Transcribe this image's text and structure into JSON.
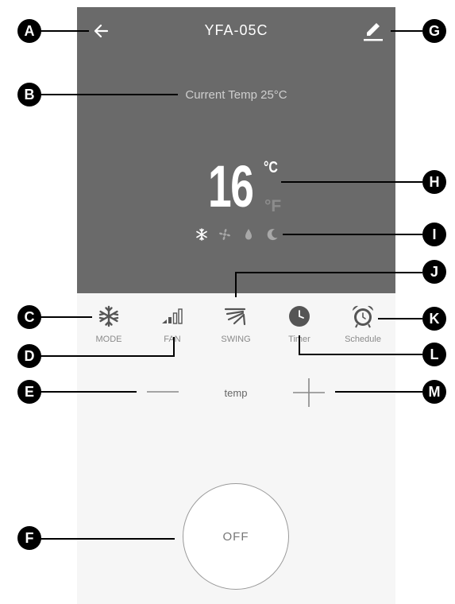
{
  "device": {
    "title": "YFA-05C",
    "current_temp_text": "Current Temp 25°C",
    "set_temp": "16",
    "unit_celsius": "°C",
    "unit_fahrenheit": "°F",
    "mode_indicators": [
      "snowflake-icon",
      "fan-icon",
      "droplet-icon",
      "moon-icon"
    ]
  },
  "functions": [
    {
      "label": "MODE",
      "icon": "snowflake-icon"
    },
    {
      "label": "FAN",
      "icon": "signal-bars-icon"
    },
    {
      "label": "SWING",
      "icon": "swing-icon"
    },
    {
      "label": "Timer",
      "icon": "clock-icon"
    },
    {
      "label": "Schedule",
      "icon": "alarm-clock-icon"
    }
  ],
  "controls": {
    "temp_label": "temp",
    "power_label": "OFF"
  },
  "callouts": [
    "A",
    "B",
    "C",
    "D",
    "E",
    "F",
    "G",
    "H",
    "I",
    "J",
    "K",
    "L",
    "M"
  ],
  "colors": {
    "panel": "#6a6a6a",
    "control_area": "#f6f6f6",
    "callout": "#000000"
  }
}
